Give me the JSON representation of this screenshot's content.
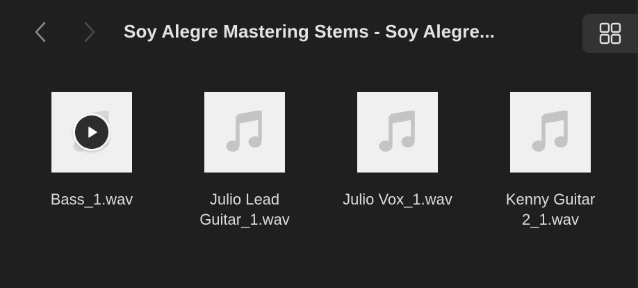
{
  "toolbar": {
    "title": "Soy Alegre Mastering Stems - Soy Alegre...",
    "back_icon": "chevron-left-icon",
    "forward_icon": "chevron-right-icon",
    "view_icon": "grid-view-icon"
  },
  "files": [
    {
      "name": "Bass_1.wav",
      "icon": "music-note-icon",
      "playing_overlay": true
    },
    {
      "name": "Julio Lead\nGuitar_1.wav",
      "icon": "music-note-icon",
      "playing_overlay": false
    },
    {
      "name": "Julio Vox_1.wav",
      "icon": "music-note-icon",
      "playing_overlay": false
    },
    {
      "name": "Kenny  Guitar\n2_1.wav",
      "icon": "music-note-icon",
      "playing_overlay": false
    }
  ],
  "colors": {
    "background": "#1f1f1f",
    "thumbnail": "#f0f0f0",
    "note": "#c4c4c4",
    "text": "#dcdcdc"
  }
}
